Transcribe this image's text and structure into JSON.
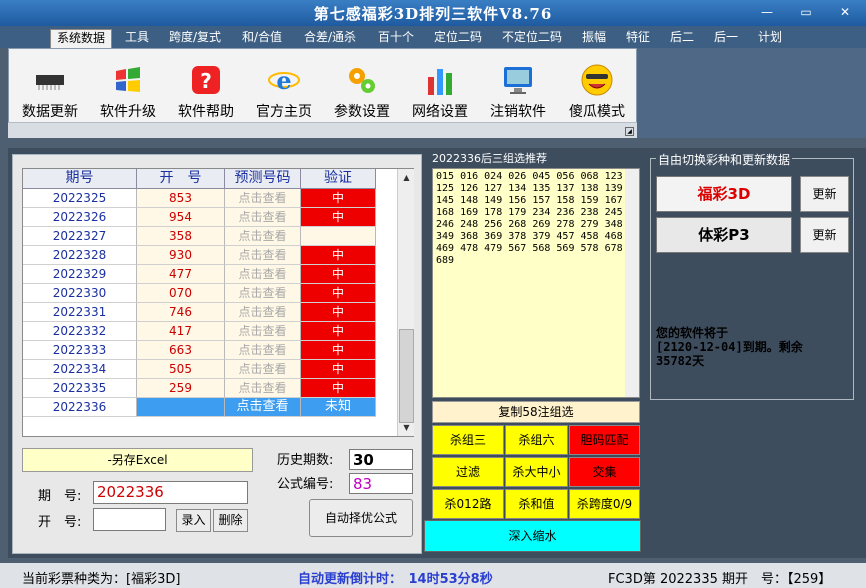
{
  "app": {
    "title": "第七感福彩3D排列三软件V8.76"
  },
  "window_buttons": {
    "minimize": "—",
    "maximize": "▭",
    "close": "✕"
  },
  "menu": [
    "系统数据",
    "工具",
    "跨度/复式",
    "和/合值",
    "合差/通杀",
    "百十个",
    "定位二码",
    "不定位二码",
    "振幅",
    "特征",
    "后二",
    "后一",
    "计划"
  ],
  "toolbar": [
    {
      "label": "数据更新",
      "icon": "chip-icon"
    },
    {
      "label": "软件升级",
      "icon": "windows-icon"
    },
    {
      "label": "软件帮助",
      "icon": "help-icon"
    },
    {
      "label": "官方主页",
      "icon": "ie-icon"
    },
    {
      "label": "参数设置",
      "icon": "gears-icon"
    },
    {
      "label": "网络设置",
      "icon": "bars-icon"
    },
    {
      "label": "注销软件",
      "icon": "monitor-icon"
    },
    {
      "label": "傻瓜模式",
      "icon": "smiley-icon"
    }
  ],
  "grid": {
    "headers": [
      "期号",
      "开　号",
      "预测号码",
      "验证"
    ],
    "rows": [
      {
        "issue": "2022325",
        "open": "853",
        "pred": "点击查看",
        "ver": "中"
      },
      {
        "issue": "2022326",
        "open": "954",
        "pred": "点击查看",
        "ver": "中"
      },
      {
        "issue": "2022327",
        "open": "358",
        "pred": "点击查看",
        "ver": ""
      },
      {
        "issue": "2022328",
        "open": "930",
        "pred": "点击查看",
        "ver": "中"
      },
      {
        "issue": "2022329",
        "open": "477",
        "pred": "点击查看",
        "ver": "中"
      },
      {
        "issue": "2022330",
        "open": "070",
        "pred": "点击查看",
        "ver": "中"
      },
      {
        "issue": "2022331",
        "open": "746",
        "pred": "点击查看",
        "ver": "中"
      },
      {
        "issue": "2022332",
        "open": "417",
        "pred": "点击查看",
        "ver": "中"
      },
      {
        "issue": "2022333",
        "open": "663",
        "pred": "点击查看",
        "ver": "中"
      },
      {
        "issue": "2022334",
        "open": "505",
        "pred": "点击查看",
        "ver": "中"
      },
      {
        "issue": "2022335",
        "open": "259",
        "pred": "点击查看",
        "ver": "中"
      },
      {
        "issue": "2022336",
        "open": "",
        "pred": "点击查看",
        "ver": "未知"
      }
    ]
  },
  "save_excel": "-另存Excel",
  "form": {
    "issue_label": "期　号:",
    "issue_value": "2022336",
    "open_label": "开　号:",
    "open_value": "",
    "history_label": "历史期数:",
    "history_value": "30",
    "formula_label": "公式编号:",
    "formula_value": "83",
    "enter_btn": "录入",
    "delete_btn": "删除",
    "auto_btn": "自动择优公式"
  },
  "recommend": {
    "title": "2022336后三组选推荐",
    "numbers": "015 016 024 026 045 056 068 123 125 126 127 134 135 137 138 139 145 148 149 156 157 158 159 167 168 169 178 179 234 236 238 245 246 248 256 268 269 278 279 348 349 368 369 378 379 457 458 468 469 478 479 567 568 569 578 678 689",
    "copy_btn": "复制58注组选",
    "buttons": [
      {
        "label": "杀组三",
        "color": "#ffff00"
      },
      {
        "label": "杀组六",
        "color": "#ffff00"
      },
      {
        "label": "胆码匹配",
        "color": "#ff0000"
      },
      {
        "label": "过滤",
        "color": "#ffff00"
      },
      {
        "label": "杀大中小",
        "color": "#ffff00"
      },
      {
        "label": "交集",
        "color": "#ff0000"
      },
      {
        "label": "杀012路",
        "color": "#ffff00"
      },
      {
        "label": "杀和值",
        "color": "#ffff00"
      },
      {
        "label": "杀跨度0/9",
        "color": "#ffff00"
      }
    ],
    "zoom_btn": "深入缩水"
  },
  "right": {
    "title": "自由切换彩种和更新数据",
    "lottery1": "福彩3D",
    "lottery2": "体彩P3",
    "update": "更新",
    "expire_line1": "您的软件将于",
    "expire_line2": "[2120-12-04]到期。剩余",
    "expire_line3": "35782天"
  },
  "status": {
    "left": "当前彩票种类为：[福彩3D]",
    "mid": "自动更新倒计时：　14时53分8秒",
    "right": "FC3D第 2022335 期开　号：【259】"
  }
}
